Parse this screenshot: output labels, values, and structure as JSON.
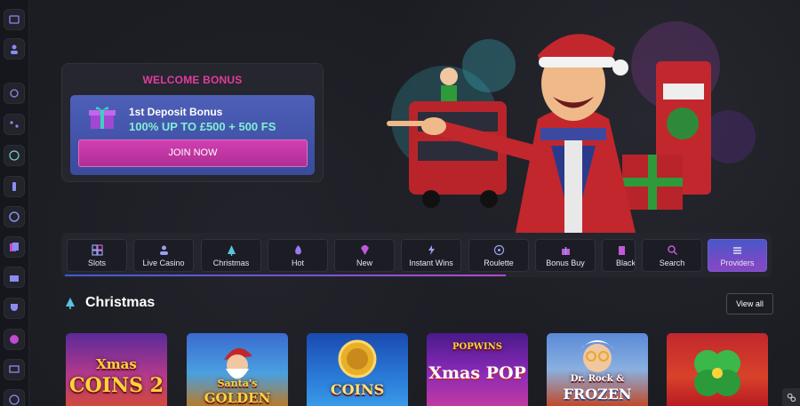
{
  "welcome": {
    "title": "WELCOME BONUS",
    "line1": "1st Deposit Bonus",
    "line2": "100% UP TO £500 + 500 FS",
    "cta": "JOIN NOW"
  },
  "categories": [
    {
      "label": "Slots",
      "icon": "grid-icon"
    },
    {
      "label": "Live Casino",
      "icon": "dealer-icon"
    },
    {
      "label": "Christmas",
      "icon": "tree-icon"
    },
    {
      "label": "Hot",
      "icon": "flame-icon"
    },
    {
      "label": "New",
      "icon": "diamond-icon"
    },
    {
      "label": "Instant Wins",
      "icon": "bolt-icon"
    },
    {
      "label": "Roulette",
      "icon": "roulette-icon"
    },
    {
      "label": "Bonus Buy",
      "icon": "gift-icon"
    },
    {
      "label": "Black",
      "icon": "cards-icon"
    },
    {
      "label": "Search",
      "icon": "search-icon"
    },
    {
      "label": "Providers",
      "icon": "providers-icon"
    }
  ],
  "section": {
    "title": "Christmas",
    "view_all": "View all"
  },
  "games": [
    {
      "title": "Xmas COINS 2",
      "line_a": "Xmas",
      "line_b": "COINS 2"
    },
    {
      "title": "Santa's GOLDEN",
      "line_a": "Santa's",
      "line_b": "GOLDEN"
    },
    {
      "title": "COINS",
      "line_a": "",
      "line_b": "COINS"
    },
    {
      "title": "POPWINS Xmas POP",
      "line_a": "POPWINS",
      "line_b": "Xmas POP"
    },
    {
      "title": "Dr. Rock & FROZEN",
      "line_a": "Dr. Rock &",
      "line_b": "FROZEN"
    },
    {
      "title": "Clover",
      "line_a": "",
      "line_b": ""
    }
  ],
  "colors": {
    "accent_pink": "#e33b9f",
    "accent_teal": "#7ff0d4",
    "bonus_blue": "#4d5fb8",
    "active_tab": "#6a5fd6"
  }
}
